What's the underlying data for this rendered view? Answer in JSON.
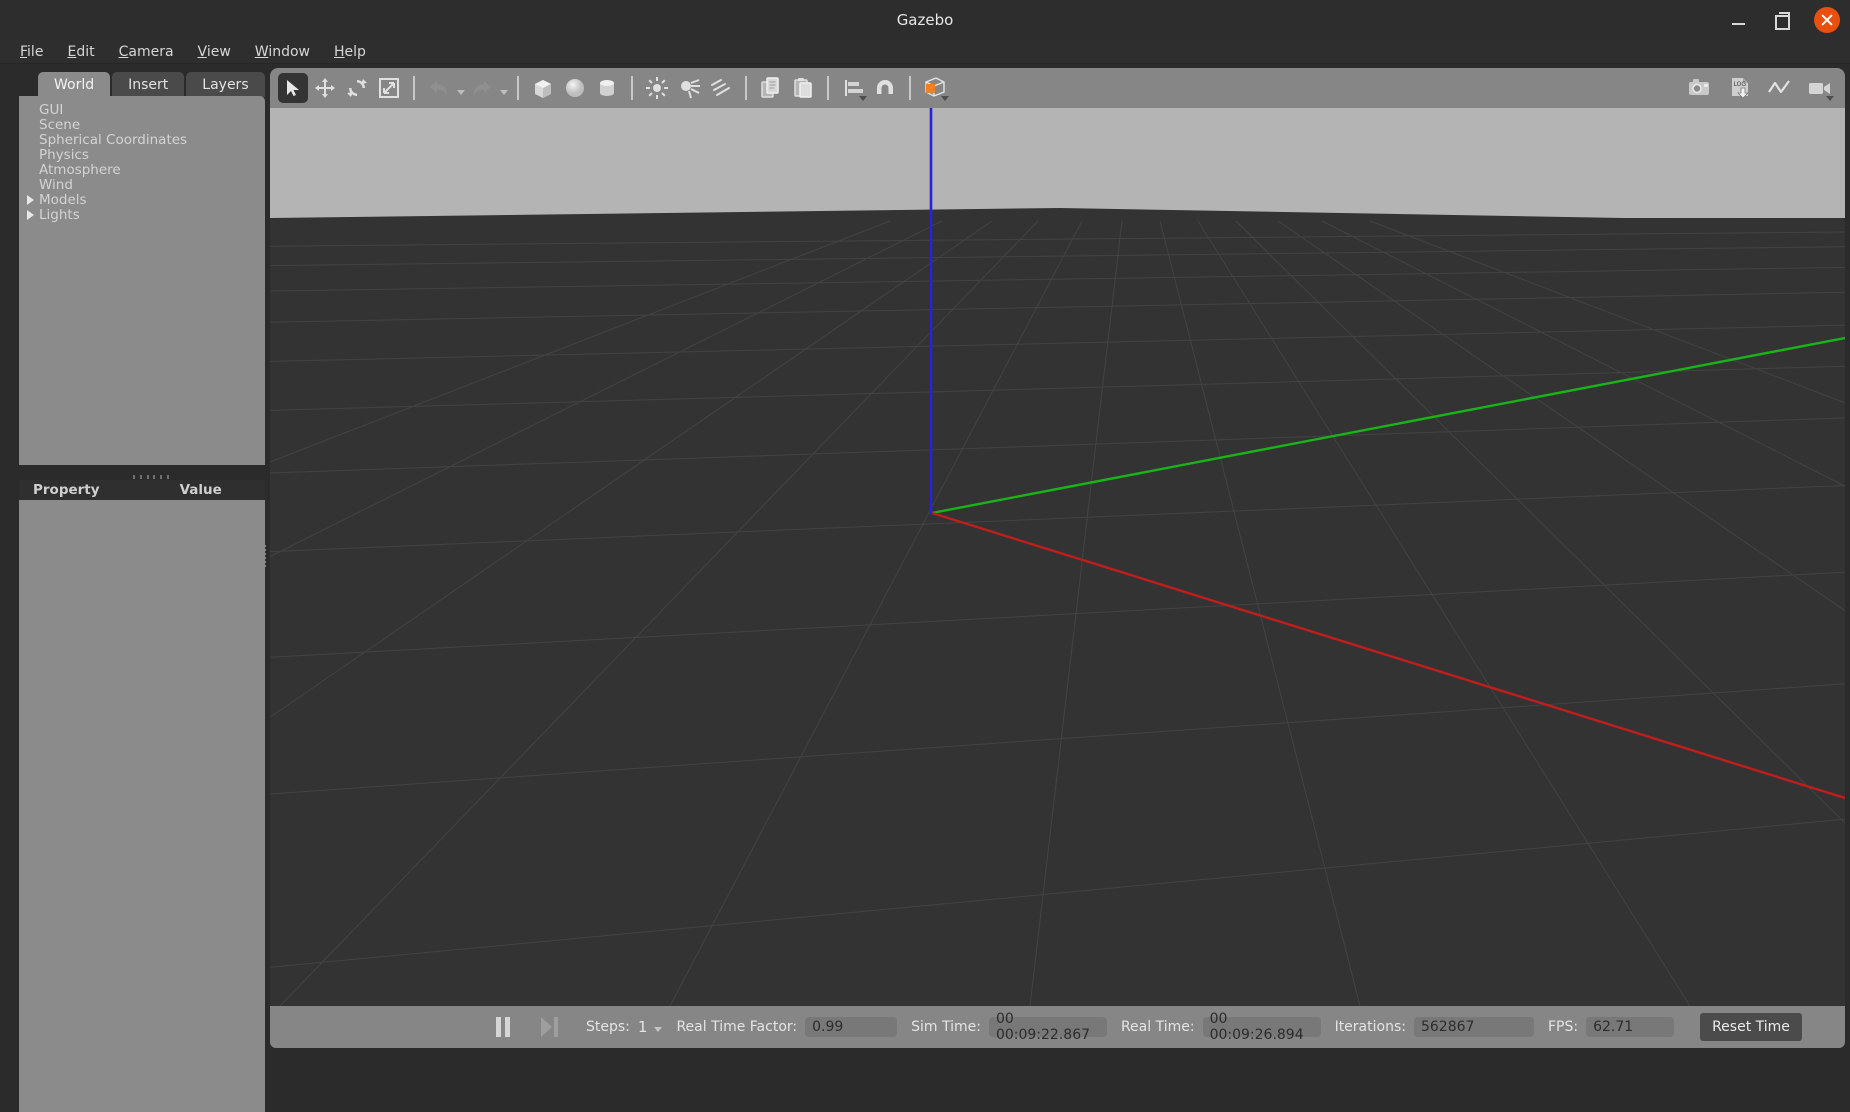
{
  "window": {
    "title": "Gazebo",
    "minimize_icon": "minimize-icon",
    "maximize_icon": "maximize-icon",
    "close_icon": "close-icon"
  },
  "menubar": {
    "items": [
      {
        "label": "File",
        "mnemonic": "F"
      },
      {
        "label": "Edit",
        "mnemonic": "E"
      },
      {
        "label": "Camera",
        "mnemonic": "C"
      },
      {
        "label": "View",
        "mnemonic": "V"
      },
      {
        "label": "Window",
        "mnemonic": "W"
      },
      {
        "label": "Help",
        "mnemonic": "H"
      }
    ]
  },
  "left_panel": {
    "tabs": [
      {
        "label": "World",
        "active": true
      },
      {
        "label": "Insert",
        "active": false
      },
      {
        "label": "Layers",
        "active": false
      }
    ],
    "tree": [
      {
        "label": "GUI",
        "expandable": false
      },
      {
        "label": "Scene",
        "expandable": false
      },
      {
        "label": "Spherical Coordinates",
        "expandable": false
      },
      {
        "label": "Physics",
        "expandable": false
      },
      {
        "label": "Atmosphere",
        "expandable": false
      },
      {
        "label": "Wind",
        "expandable": false
      },
      {
        "label": "Models",
        "expandable": true
      },
      {
        "label": "Lights",
        "expandable": true
      }
    ],
    "property_table": {
      "columns": [
        "Property",
        "Value"
      ],
      "rows": []
    }
  },
  "toolbar": {
    "left_items": [
      {
        "name": "select-mode-button",
        "icon": "cursor-arrow-icon",
        "active": true
      },
      {
        "name": "translate-mode-button",
        "icon": "move-arrows-icon",
        "active": false
      },
      {
        "name": "rotate-mode-button",
        "icon": "rotate-icon",
        "active": false
      },
      {
        "name": "scale-mode-button",
        "icon": "scale-icon",
        "active": false
      },
      {
        "name": "undo-button",
        "icon": "undo-arrow-icon",
        "active": false
      },
      {
        "name": "undo-history-dropdown",
        "icon": "chevron-down-icon",
        "active": false
      },
      {
        "name": "redo-button",
        "icon": "redo-arrow-icon",
        "active": false
      },
      {
        "name": "redo-history-dropdown",
        "icon": "chevron-down-icon",
        "active": false
      },
      {
        "name": "insert-box-button",
        "icon": "box-icon",
        "active": false
      },
      {
        "name": "insert-sphere-button",
        "icon": "sphere-icon",
        "active": false
      },
      {
        "name": "insert-cylinder-button",
        "icon": "cylinder-icon",
        "active": false
      },
      {
        "name": "insert-point-light-button",
        "icon": "point-light-icon",
        "active": false
      },
      {
        "name": "insert-spot-light-button",
        "icon": "spot-light-icon",
        "active": false
      },
      {
        "name": "insert-directional-light-button",
        "icon": "directional-light-icon",
        "active": false
      },
      {
        "name": "copy-button",
        "icon": "copy-icon",
        "active": false
      },
      {
        "name": "paste-button",
        "icon": "paste-icon",
        "active": false
      },
      {
        "name": "align-button",
        "icon": "align-icon",
        "active": false
      },
      {
        "name": "snap-button",
        "icon": "magnet-icon",
        "active": false
      },
      {
        "name": "view-angle-button",
        "icon": "view-angle-cube-icon",
        "active": false
      }
    ],
    "right_items": [
      {
        "name": "screenshot-button",
        "icon": "camera-icon"
      },
      {
        "name": "log-button",
        "icon": "log-download-icon",
        "label": "LOG"
      },
      {
        "name": "plot-button",
        "icon": "plot-line-icon"
      },
      {
        "name": "record-video-button",
        "icon": "video-camera-icon"
      }
    ],
    "accent_color": "#f08024"
  },
  "viewport": {
    "sky_color": "#b4b4b4",
    "ground_color": "#333333",
    "grid_color": "#4a4a4a",
    "axes": [
      {
        "name": "x-axis",
        "color": "#cc2222"
      },
      {
        "name": "y-axis",
        "color": "#22bb22"
      },
      {
        "name": "z-axis",
        "color": "#2222dd"
      }
    ]
  },
  "statusbar": {
    "pause_button": "pause-icon",
    "step_button": "step-forward-icon",
    "steps_label": "Steps:",
    "steps_value": "1",
    "real_time_factor_label": "Real Time Factor:",
    "real_time_factor_value": "0.99",
    "sim_time_label": "Sim Time:",
    "sim_time_value": "00 00:09:22.867",
    "real_time_label": "Real Time:",
    "real_time_value": "00 00:09:26.894",
    "iterations_label": "Iterations:",
    "iterations_value": "562867",
    "fps_label": "FPS:",
    "fps_value": "62.71",
    "reset_time_label": "Reset Time"
  }
}
